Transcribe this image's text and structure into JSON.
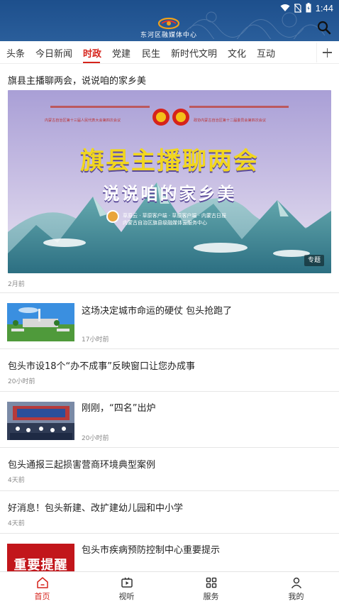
{
  "status": {
    "time": "1:44"
  },
  "header": {
    "logo_text": "东河区融媒体中心",
    "search_icon": "search-icon"
  },
  "tabs": [
    {
      "label": "头条",
      "active": false
    },
    {
      "label": "今日新闻",
      "active": false
    },
    {
      "label": "时政",
      "active": true
    },
    {
      "label": "党建",
      "active": false
    },
    {
      "label": "民生",
      "active": false
    },
    {
      "label": "新时代文明",
      "active": false
    },
    {
      "label": "文化",
      "active": false
    },
    {
      "label": "互动",
      "active": false
    }
  ],
  "featured": {
    "title": "旗县主播聊两会，说说咱的家乡美",
    "banner_line1": "旗县主播聊两会",
    "banner_line2": "说说咱的家乡美",
    "banner_sub1": "草原云 · 草原客户端 · 草原客户端 · 内蒙古日报",
    "banner_sub2": "内蒙古自治区旗县级融媒体云服务中心",
    "banner_top_left": "内蒙古自治区第十三届人民代表大会第四次会议",
    "banner_top_right": "政协内蒙古自治区第十二届委员会第四次会议",
    "badge": "专题",
    "time": "2月前"
  },
  "items": [
    {
      "title": "这场决定城市命运的硬仗  包头抢跑了",
      "time": "17小时前",
      "has_thumb": true
    },
    {
      "title": "包头市设18个“办不成事”反映窗口让您办成事",
      "time": "20小时前",
      "has_thumb": false
    },
    {
      "title": "刚刚，“四名”出炉",
      "time": "20小时前",
      "has_thumb": true
    },
    {
      "title": "包头通报三起损害营商环境典型案例",
      "time": "4天前",
      "has_thumb": false
    },
    {
      "title": "好消息！包头新建、改扩建幼儿园和中小学",
      "time": "4天前",
      "has_thumb": false
    },
    {
      "title": "包头市疾病预防控制中心重要提示",
      "thumb_text": "重要提醒",
      "has_thumb": true
    }
  ],
  "bottom_nav": [
    {
      "label": "首页",
      "icon": "home-icon",
      "active": true
    },
    {
      "label": "视听",
      "icon": "video-icon",
      "active": false
    },
    {
      "label": "服务",
      "icon": "grid-icon",
      "active": false
    },
    {
      "label": "我的",
      "icon": "user-icon",
      "active": false
    }
  ],
  "colors": {
    "header_blue": "#1d4f8c",
    "accent_red": "#d6231b"
  }
}
